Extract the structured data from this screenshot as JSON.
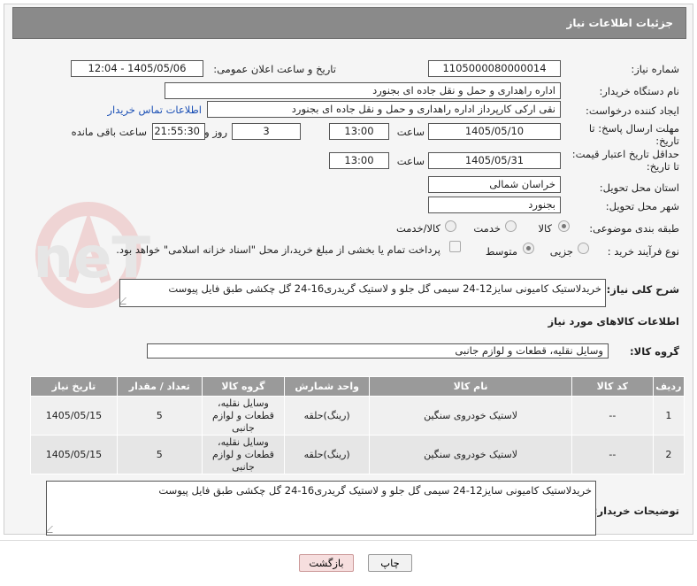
{
  "header": {
    "title": "جزئیات اطلاعات نیاز"
  },
  "fields": {
    "need_number": {
      "label": "شماره نیاز:",
      "value": "1105000080000014"
    },
    "announce_datetime": {
      "label": "تاریخ و ساعت اعلان عمومی:",
      "value": "1405/05/06 - 12:04"
    },
    "buyer_org": {
      "label": "نام دستگاه خریدار:",
      "value": "اداره راهداری و حمل و نقل جاده ای بجنورد"
    },
    "requester": {
      "label": "ایجاد کننده درخواست:",
      "value": "نقی ارکی کارپرداز اداره راهداری و حمل و نقل جاده ای بجنورد",
      "contact_link": "اطلاعات تماس خریدار"
    },
    "reply_deadline": {
      "label_line1": "مهلت ارسال پاسخ: تا",
      "label_line2": "تاریخ:",
      "date": "1405/05/10",
      "time_label": "ساعت",
      "time": "13:00",
      "days": "3",
      "days_label": "روز و",
      "remaining": "21:55:30",
      "remaining_label": "ساعت باقی مانده"
    },
    "price_validity": {
      "label_line1": "حداقل تاریخ اعتبار قیمت:",
      "label_line2": "تا تاریخ:",
      "date": "1405/05/31",
      "time_label": "ساعت",
      "time": "13:00"
    },
    "delivery_province": {
      "label": "استان محل تحویل:",
      "value": "خراسان شمالی"
    },
    "delivery_city": {
      "label": "شهر محل تحویل:",
      "value": "بجنورد"
    },
    "category": {
      "label": "طبقه بندی موضوعی:",
      "options": [
        "کالا",
        "خدمت",
        "کالا/خدمت"
      ],
      "selected": "کالا"
    },
    "process_type": {
      "label": "نوع فرآیند خرید :",
      "options": [
        "جزیی",
        "متوسط"
      ],
      "selected": "متوسط",
      "payment_note": "پرداخت تمام یا بخشی از مبلغ خرید،از محل \"اسناد خزانه اسلامی\" خواهد بود."
    }
  },
  "description": {
    "label": "شرح کلی نیاز:",
    "value": "خریدلاستیک کامیونی سایز12-24 سیمی گل جلو و لاستیک گریدری16-24 گل چکشی طبق فایل پیوست"
  },
  "goods_section": {
    "title": "اطلاعات کالاهای مورد نیاز",
    "group_label": "گروه کالا:",
    "group_value": "وسایل نقلیه، قطعات و لوازم جانبی"
  },
  "table": {
    "headers": [
      "ردیف",
      "کد کالا",
      "نام کالا",
      "واحد شمارش",
      "گروه کالا",
      "تعداد / مقدار",
      "تاریخ نیاز"
    ],
    "rows": [
      {
        "row": "1",
        "code": "--",
        "name": "لاستیک خودروی سنگین",
        "unit": "(رینگ)حلقه",
        "group": "وسایل نقلیه، قطعات و لوازم جانبی",
        "qty": "5",
        "date": "1405/05/15"
      },
      {
        "row": "2",
        "code": "--",
        "name": "لاستیک خودروی سنگین",
        "unit": "(رینگ)حلقه",
        "group": "وسایل نقلیه، قطعات و لوازم جانبی",
        "qty": "5",
        "date": "1405/05/15"
      }
    ]
  },
  "buyer_notes": {
    "label": "توضیحات خریدار:",
    "value": "خریدلاستیک کامیونی سایز12-24 سیمی گل جلو و لاستیک گریدری16-24 گل چکشی طبق فایل پیوست"
  },
  "buttons": {
    "print": "چاپ",
    "back": "بازگشت"
  },
  "watermark": {
    "text": "AriaTender.neT"
  }
}
